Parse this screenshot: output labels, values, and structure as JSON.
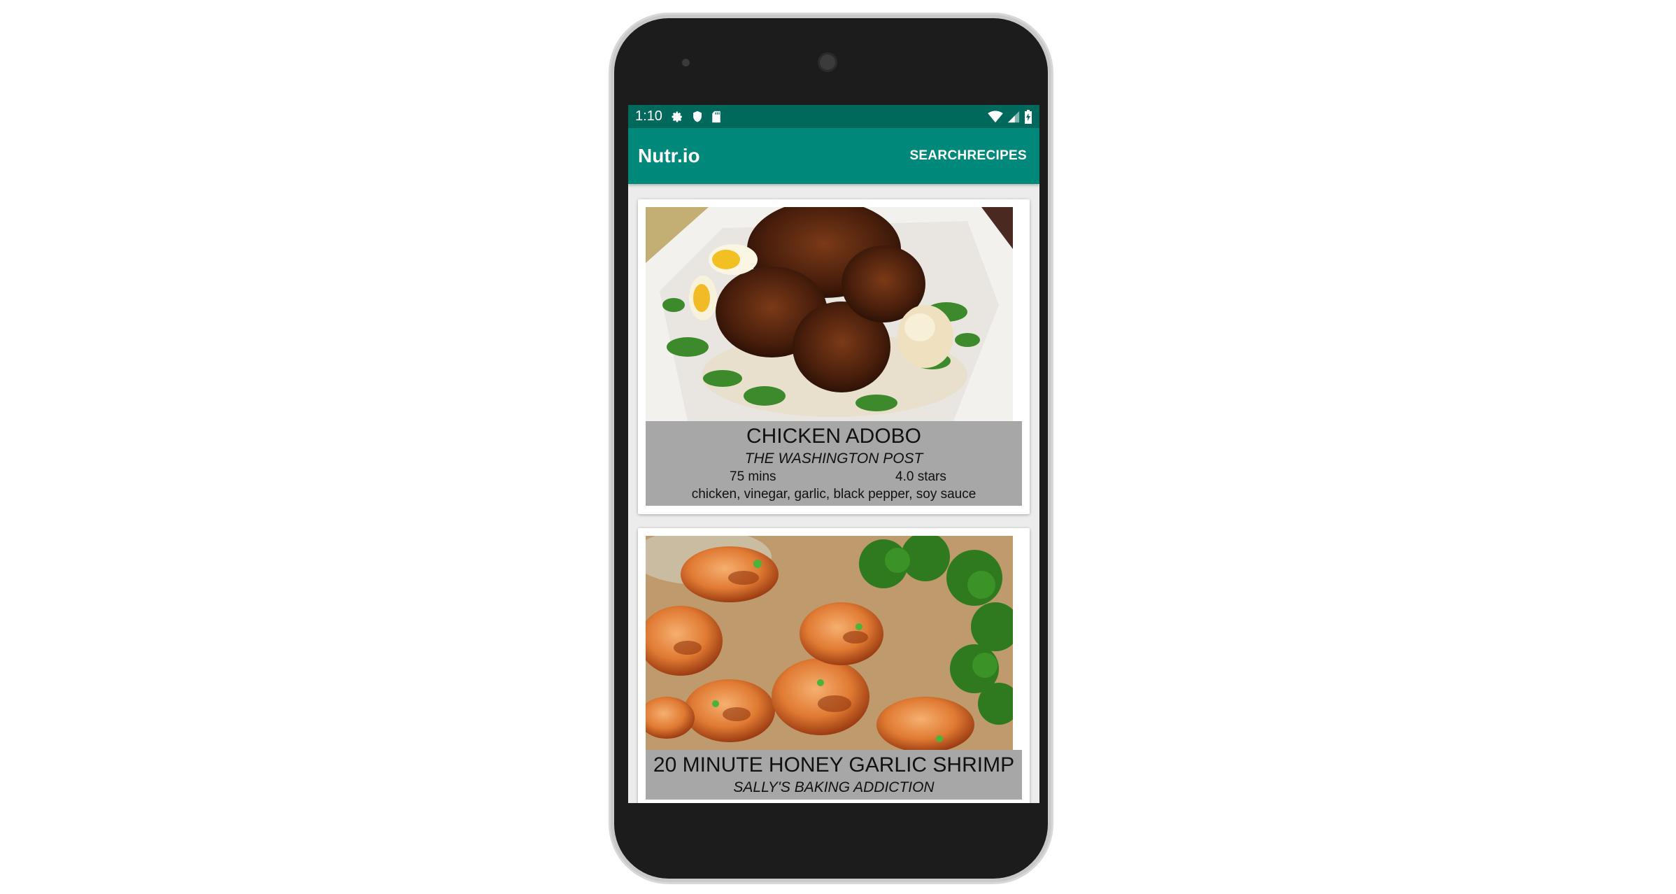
{
  "statusbar": {
    "time": "1:10",
    "left_icons": [
      "gear-icon",
      "shield-icon",
      "sd-card-icon"
    ],
    "right_icons": [
      "wifi-icon",
      "signal-icon",
      "battery-icon"
    ]
  },
  "appbar": {
    "title": "Nutr.io",
    "action": "SEARCHRECIPES"
  },
  "colors": {
    "statusbar": "#00695c",
    "appbar": "#00897b",
    "info_panel": "#a7a7a7"
  },
  "recipes": [
    {
      "title": "CHICKEN ADOBO",
      "source": "THE WASHINGTON POST",
      "time": "75 mins",
      "rating": "4.0 stars",
      "ingredients": "chicken, vinegar, garlic, black pepper, soy sauce"
    },
    {
      "title": "20 MINUTE HONEY GARLIC SHRIMP",
      "source": "SALLY'S BAKING ADDICTION"
    }
  ]
}
